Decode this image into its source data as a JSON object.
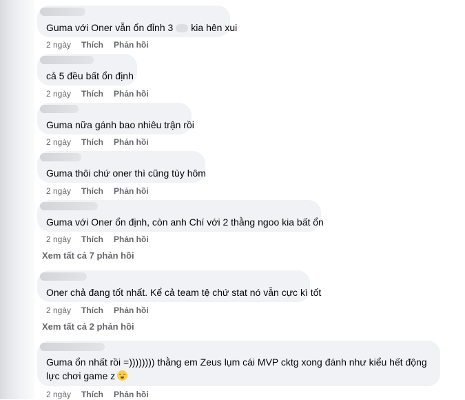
{
  "comments": [
    {
      "text_before": "Guma với Oner vẫn ổn đỉnh 3",
      "text_after": "kia hên xui",
      "time": "2 ngày",
      "like": "Thích",
      "reply": "Phản hồi"
    },
    {
      "text": "cả 5 đều bất ổn định",
      "time": "2 ngày",
      "like": "Thích",
      "reply": "Phản hồi"
    },
    {
      "text": "Guma nữa gánh bao nhiêu trận rồi",
      "time": "2 ngày",
      "like": "Thích",
      "reply": "Phản hồi"
    },
    {
      "text": "Guma thôi chứ oner thì cũng tùy hôm",
      "time": "2 ngày",
      "like": "Thích",
      "reply": "Phản hồi"
    },
    {
      "text": "Guma với Oner ổn định, còn anh Chí với 2 thằng ngoo kia bất ổn",
      "time": "2 ngày",
      "like": "Thích",
      "reply": "Phản hồi",
      "view_more": "Xem tất cả 7 phản hồi"
    },
    {
      "text": "Oner chả đang tốt nhất. Kể cả team tệ chứ stat nó vẫn cực kì tốt",
      "time": "2 ngày",
      "like": "Thích",
      "reply": "Phản hồi",
      "view_more": "Xem tất cả 2 phản hồi"
    },
    {
      "text": "Guma ổn nhất rồi =)))))))) thằng em Zeus lụm cái MVP cktg xong đánh như kiểu hết động lực chơi game z",
      "emoji": "grinning-squint-face",
      "time": "2 ngày",
      "like": "Thích",
      "reply": "Phản hồi"
    }
  ]
}
